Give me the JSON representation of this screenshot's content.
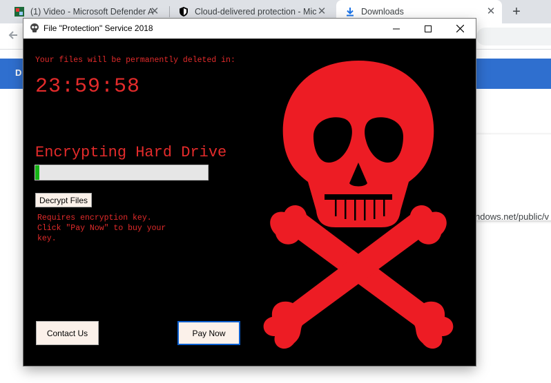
{
  "browser": {
    "tabs": [
      {
        "title": "(1) Video - Microsoft Defender A",
        "icon": "video-favicon"
      },
      {
        "title": "Cloud-delivered protection - Mic",
        "icon": "shield-favicon"
      },
      {
        "title": "Downloads",
        "icon": "download-icon"
      }
    ],
    "close_glyph": "✕",
    "new_tab_glyph": "+",
    "page": {
      "bar_letter": "D",
      "url_fragment": "ndows.net/public/v"
    },
    "colors": {
      "bar": "#2f6fcf",
      "tabstrip": "#dee1e6"
    }
  },
  "window": {
    "title": "File \"Protection\" Service 2018",
    "warning": "Your files will be permanently deleted in:",
    "timer": "23:59:58",
    "encrypting_label": "Encrypting Hard Drive",
    "progress": 0.025,
    "decrypt_label": "Decrypt Files",
    "note_lines": [
      "Requires encryption key.",
      "Click \"Pay Now\" to buy your",
      "key."
    ],
    "contact_label": "Contact Us",
    "pay_label": "Pay Now",
    "colors": {
      "text": "#e32b2b",
      "skull": "#ed1c24",
      "progress": "#15b315",
      "background": "#000000"
    }
  }
}
